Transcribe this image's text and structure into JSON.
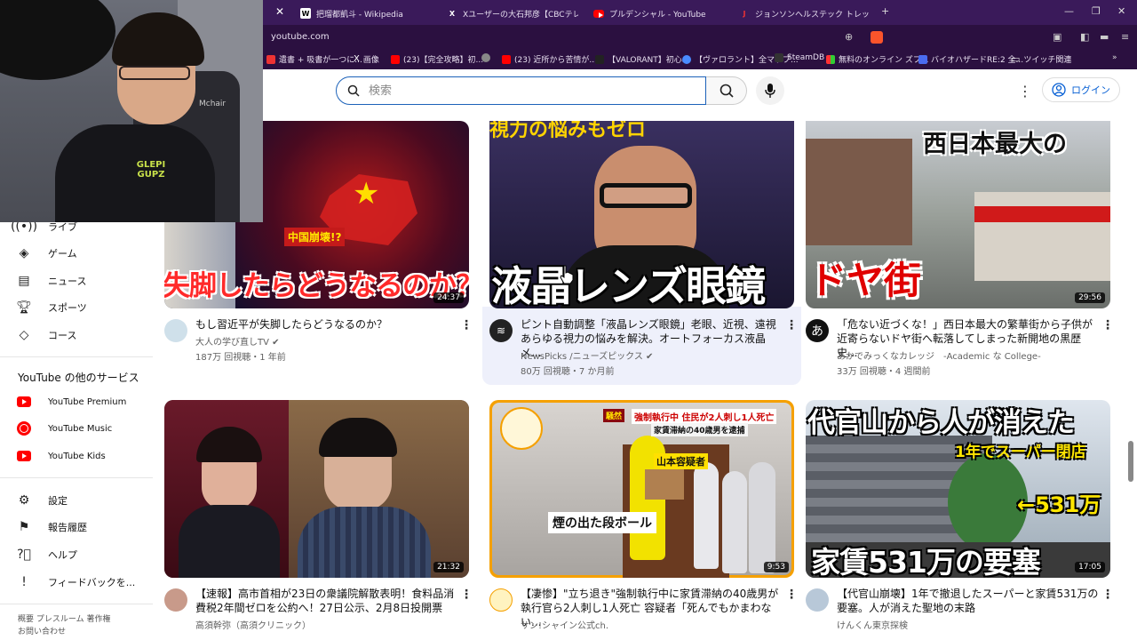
{
  "browser": {
    "tabs": [
      {
        "label": "把瑠都凱斗 - Wikipedia",
        "icon": "W"
      },
      {
        "label": "Xユーザーの大石邦彦【CBCテレビ解説員...",
        "icon": "X"
      },
      {
        "label": "プルデンシャル - YouTube",
        "icon": "yt"
      },
      {
        "label": "ジョンソンヘルステック トレッドミル 業務用...",
        "icon": "J"
      }
    ],
    "url": "youtube.com",
    "bookmarks": [
      "遺書 + 吸書が一つに...",
      "画像",
      "(23)【完全攻略】初...",
      "",
      "(23) 近所から苦情が...",
      "【VALORANT】初心...",
      "【ヴァロラント】全マップ...",
      "SteamDB",
      "無料のオンライン ズプ...",
      "バイオハザードRE:2 全...",
      "ツイッチ関連"
    ]
  },
  "header": {
    "search_placeholder": "検索",
    "login_label": "ログイン"
  },
  "sidebar": {
    "items_top": [
      {
        "label": "ライブ",
        "icon": "live-icon"
      },
      {
        "label": "ゲーム",
        "icon": "gamepad-icon"
      },
      {
        "label": "ニュース",
        "icon": "news-icon"
      },
      {
        "label": "スポーツ",
        "icon": "trophy-icon"
      },
      {
        "label": "コース",
        "icon": "course-icon"
      }
    ],
    "other_services_heading": "YouTube の他のサービス",
    "services": [
      "YouTube Premium",
      "YouTube Music",
      "YouTube Kids"
    ],
    "settings": [
      {
        "label": "設定",
        "icon": "gear-icon"
      },
      {
        "label": "報告履歴",
        "icon": "flag-icon"
      },
      {
        "label": "ヘルプ",
        "icon": "help-icon"
      },
      {
        "label": "フィードバックを...",
        "icon": "feedback-icon"
      }
    ],
    "footer_line1": "概要 プレスルーム 著作権",
    "footer_line2": "お問い合わせ"
  },
  "webcam": {
    "chair_text": "Mchair",
    "shirt_text": "GLEPI GUPZ"
  },
  "videos": [
    {
      "title": "もし習近平が失脚したらどうなるのか？",
      "channel": "大人の学び直しTV",
      "verified": true,
      "stats": "187万 回視聴・1 年前",
      "duration": "24:37",
      "overlay": [
        "中国崩壊!?",
        "失脚したらどうなるのか？"
      ],
      "accent": "#c41a1a"
    },
    {
      "title": "ピント自動調整「液晶レンズ眼鏡」老眼、近視、遠視あらゆる視力の悩みを解決。オートフォーカス液晶メ...",
      "channel": "NewsPicks /ニューズピックス",
      "verified": true,
      "stats": "80万 回視聴・7 か月前",
      "duration": "",
      "overlay": [
        "視力の悩みもゼロ",
        "液晶レンズ眼鏡"
      ],
      "accent": "#2a2250"
    },
    {
      "title": "「危ない近づくな！」西日本最大の繁華街から子供が近寄らないドヤ街へ転落してしまった新開地の黒歴史...",
      "channel": "あかでみっくなカレッジ　-Academic な College-",
      "verified": false,
      "stats": "33万 回視聴・4 週間前",
      "duration": "29:56",
      "overlay": [
        "西日本最大の",
        "ドヤ街"
      ],
      "accent": "#d80000"
    },
    {
      "title": "【速報】高市首相が23日の衆議院解散表明！食料品消費税2年間ゼロを公約へ！27日公示、2月8日投開票",
      "channel": "高須幹弥（高須クリニック）",
      "verified": false,
      "stats": "",
      "duration": "21:32",
      "overlay": [],
      "accent": "#3a2a2a"
    },
    {
      "title": "【凄惨】\"立ち退き\"強制執行中に家賃滞納の40歳男が執行官ら2人刺し1人死亡 容疑者「死んでもかまわない...",
      "channel": "サン!シャイン公式ch.",
      "verified": false,
      "stats": "",
      "duration": "9:53",
      "overlay": [
        "騒然",
        "強制執行中 住民が2人刺し1人死亡",
        "家賃滞納の40歳男を逮捕",
        "山本容疑者",
        "煙の出た段ボール"
      ],
      "accent": "#f5a000"
    },
    {
      "title": "【代官山崩壊】1年で撤退したスーパーと家賃531万の要塞。人が消えた聖地の末路",
      "channel": "けんくん東京探検",
      "verified": false,
      "stats": "",
      "duration": "17:05",
      "overlay": [
        "代官山から人が消えた",
        "1年でスーパー閉店",
        "←531万",
        "家賃531万の要塞"
      ],
      "accent": "#ffe600"
    }
  ]
}
